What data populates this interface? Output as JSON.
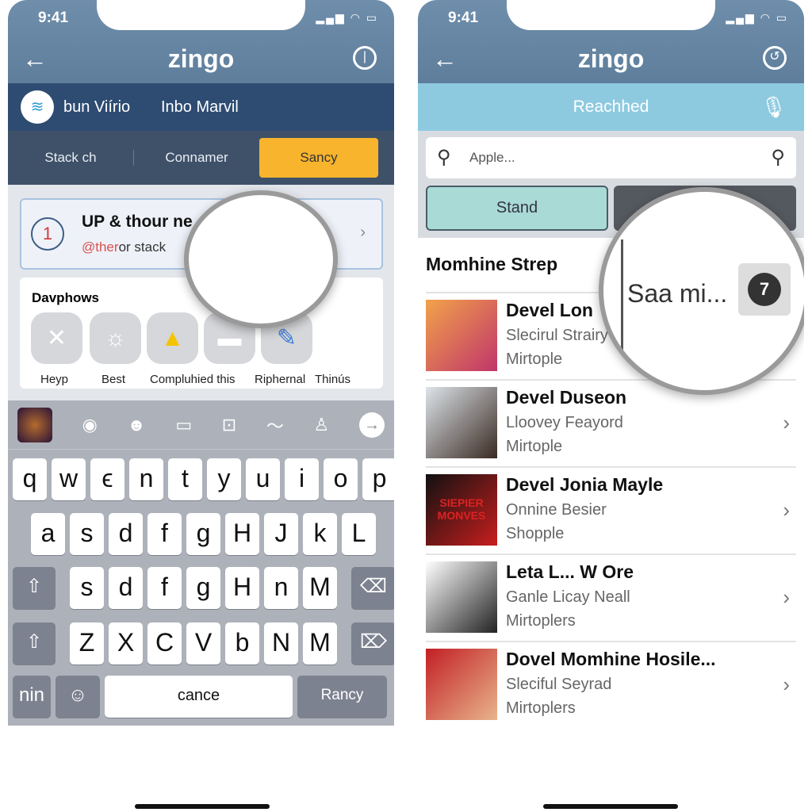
{
  "status": {
    "time": "9:41",
    "icons": "signal wifi battery"
  },
  "left": {
    "title": "zingo",
    "header_bar": {
      "logo_label": "bun Viírio",
      "inbox_label": "Inbo Marvil"
    },
    "tabs": [
      {
        "label": "Stack ch"
      },
      {
        "label": "Connamer"
      },
      {
        "label": "Sancy",
        "active": true
      }
    ],
    "card": {
      "badge": "1",
      "title": "UP & thour ne",
      "sub_highlight": "@ther",
      "sub_rest": "or stack"
    },
    "apps": {
      "heading": "Davphows",
      "items": [
        {
          "label": "Heyp"
        },
        {
          "label": "Best"
        },
        {
          "label": "Compluhied this"
        },
        {
          "label": "Riphernal"
        },
        {
          "label": "Thinús"
        }
      ]
    },
    "keyboard": {
      "row1": [
        "q",
        "w",
        "ϵ",
        "n",
        "t",
        "y",
        "u",
        "i",
        "o",
        "p"
      ],
      "row2": [
        "a",
        "s",
        "d",
        "f",
        "g",
        "H",
        "J",
        "k",
        "L"
      ],
      "row3": [
        "s",
        "d",
        "f",
        "g",
        "H",
        "n",
        "M"
      ],
      "row4": [
        "Z",
        "X",
        "C",
        "V",
        "b",
        "N",
        "M"
      ],
      "mode_key": "nin",
      "space": "cance",
      "return_key": "Rancy"
    }
  },
  "right": {
    "title": "zingo",
    "bar_label": "Reachhed",
    "search_placeholder": "Apple...",
    "segment_left": "Stand",
    "section_title": "Momhine Strep",
    "magnifier": {
      "text": "Saa mi...",
      "badge": "7"
    },
    "items": [
      {
        "title": "Devel Lon",
        "line1": "Slecirul Strairy",
        "line2": "Mirtople",
        "colors": [
          "#f2a24a",
          "#c0356a"
        ]
      },
      {
        "title": "Devel Duseon",
        "line1": "Lloovey Feayord",
        "line2": "Mirtople",
        "colors": [
          "#dde4ea",
          "#3a2a22"
        ]
      },
      {
        "title": "Devel Jonia Mayle",
        "line1": "Onnine Besier",
        "line2": "Shopple",
        "art_text": "SIEPIER MONVES",
        "colors": [
          "#111111",
          "#c81e1e"
        ]
      },
      {
        "title": "Leta L... W Ore",
        "line1": "Ganle Licay Neall",
        "line2": "Mirtoplers",
        "colors": [
          "#ffffff",
          "#222222"
        ]
      },
      {
        "title": "Dovel Momhine Hosile...",
        "line1": "Sleciful Seyrad",
        "line2": "Mirtoplers",
        "colors": [
          "#c21f24",
          "#e8b48c"
        ]
      }
    ]
  },
  "colors": {
    "header": "#5e7e9c",
    "accent_tab": "#f7b42c",
    "bar_light": "#8dcae0",
    "segment": "#a9dad6"
  }
}
